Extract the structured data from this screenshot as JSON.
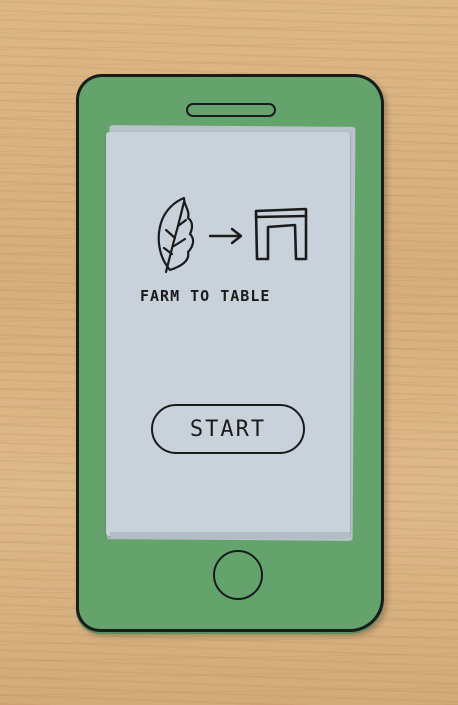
{
  "app": {
    "title": "FARM TO TABLE"
  },
  "icons": {
    "leaf": "leaf-icon",
    "arrow": "arrow-right-icon",
    "table": "table-icon"
  },
  "actions": {
    "start_label": "START"
  },
  "colors": {
    "phone_body": "#64a46c",
    "screen_paper": "#c9d2db",
    "ink": "#1b1b1b",
    "desk": "#d9b482"
  }
}
